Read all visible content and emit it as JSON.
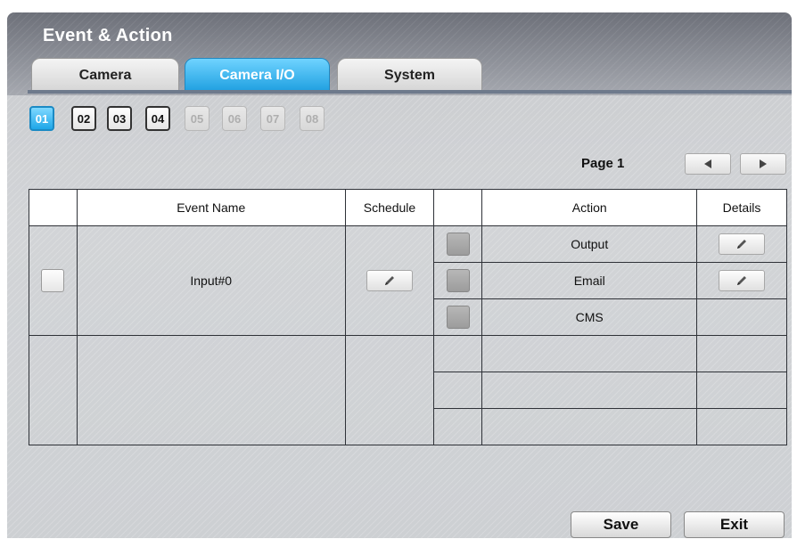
{
  "window": {
    "title": "Event & Action"
  },
  "tabs": [
    {
      "label": "Camera",
      "active": false
    },
    {
      "label": "Camera I/O",
      "active": true
    },
    {
      "label": "System",
      "active": false
    }
  ],
  "channels": [
    {
      "label": "01",
      "state": "selected"
    },
    {
      "label": "02",
      "state": "enabled"
    },
    {
      "label": "03",
      "state": "enabled"
    },
    {
      "label": "04",
      "state": "enabled"
    },
    {
      "label": "05",
      "state": "disabled"
    },
    {
      "label": "06",
      "state": "disabled"
    },
    {
      "label": "07",
      "state": "disabled"
    },
    {
      "label": "08",
      "state": "disabled"
    }
  ],
  "pagination": {
    "label": "Page 1",
    "prev_icon": "arrow-left-icon",
    "next_icon": "arrow-right-icon"
  },
  "table": {
    "headers": {
      "event_name": "Event Name",
      "schedule": "Schedule",
      "action": "Action",
      "details": "Details"
    },
    "events": [
      {
        "name": "Input#0",
        "actions": [
          {
            "label": "Output",
            "has_details": true
          },
          {
            "label": "Email",
            "has_details": true
          },
          {
            "label": "CMS",
            "has_details": false
          }
        ]
      }
    ]
  },
  "buttons": {
    "save": "Save",
    "exit": "Exit"
  },
  "colors": {
    "accent": "#1ea6e8",
    "header": "#7f828a",
    "rule": "#6e7a8c"
  }
}
